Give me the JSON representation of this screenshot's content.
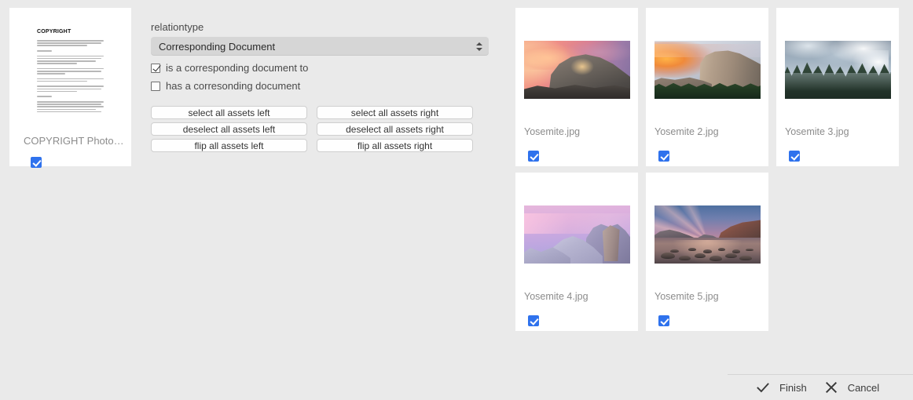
{
  "left_asset": {
    "label": "COPYRIGHT Photograph...",
    "doc_title": "COPYRIGHT",
    "checkbox_checked": true
  },
  "controls": {
    "relationtype_label": "relationtype",
    "relationtype_value": "Corresponding Document",
    "stepper_up_icon": "caret-up-icon",
    "stepper_down_icon": "caret-down-icon",
    "checkboxes": [
      {
        "label": "is a corresponding document to",
        "checked": true
      },
      {
        "label": "has a corresonding document",
        "checked": false
      }
    ],
    "buttons": [
      "select all assets left",
      "select all assets right",
      "deselect all assets left",
      "deselect all assets right",
      "flip all assets left",
      "flip all assets right"
    ]
  },
  "assets": [
    {
      "label": "Yosemite.jpg",
      "checked": true
    },
    {
      "label": "Yosemite 2.jpg",
      "checked": true
    },
    {
      "label": "Yosemite 3.jpg",
      "checked": true
    },
    {
      "label": "Yosemite 4.jpg",
      "checked": true
    },
    {
      "label": "Yosemite 5.jpg",
      "checked": true
    }
  ],
  "bottom_bar": {
    "finish_label": "Finish",
    "cancel_label": "Cancel",
    "finish_icon": "checkmark-icon",
    "cancel_icon": "close-icon"
  },
  "colors": {
    "background": "#eaeaea",
    "card": "#ffffff",
    "accent_checkbox": "#2f72ed",
    "select_bg": "#d6d6d6",
    "label_text": "#8c8c8c"
  }
}
